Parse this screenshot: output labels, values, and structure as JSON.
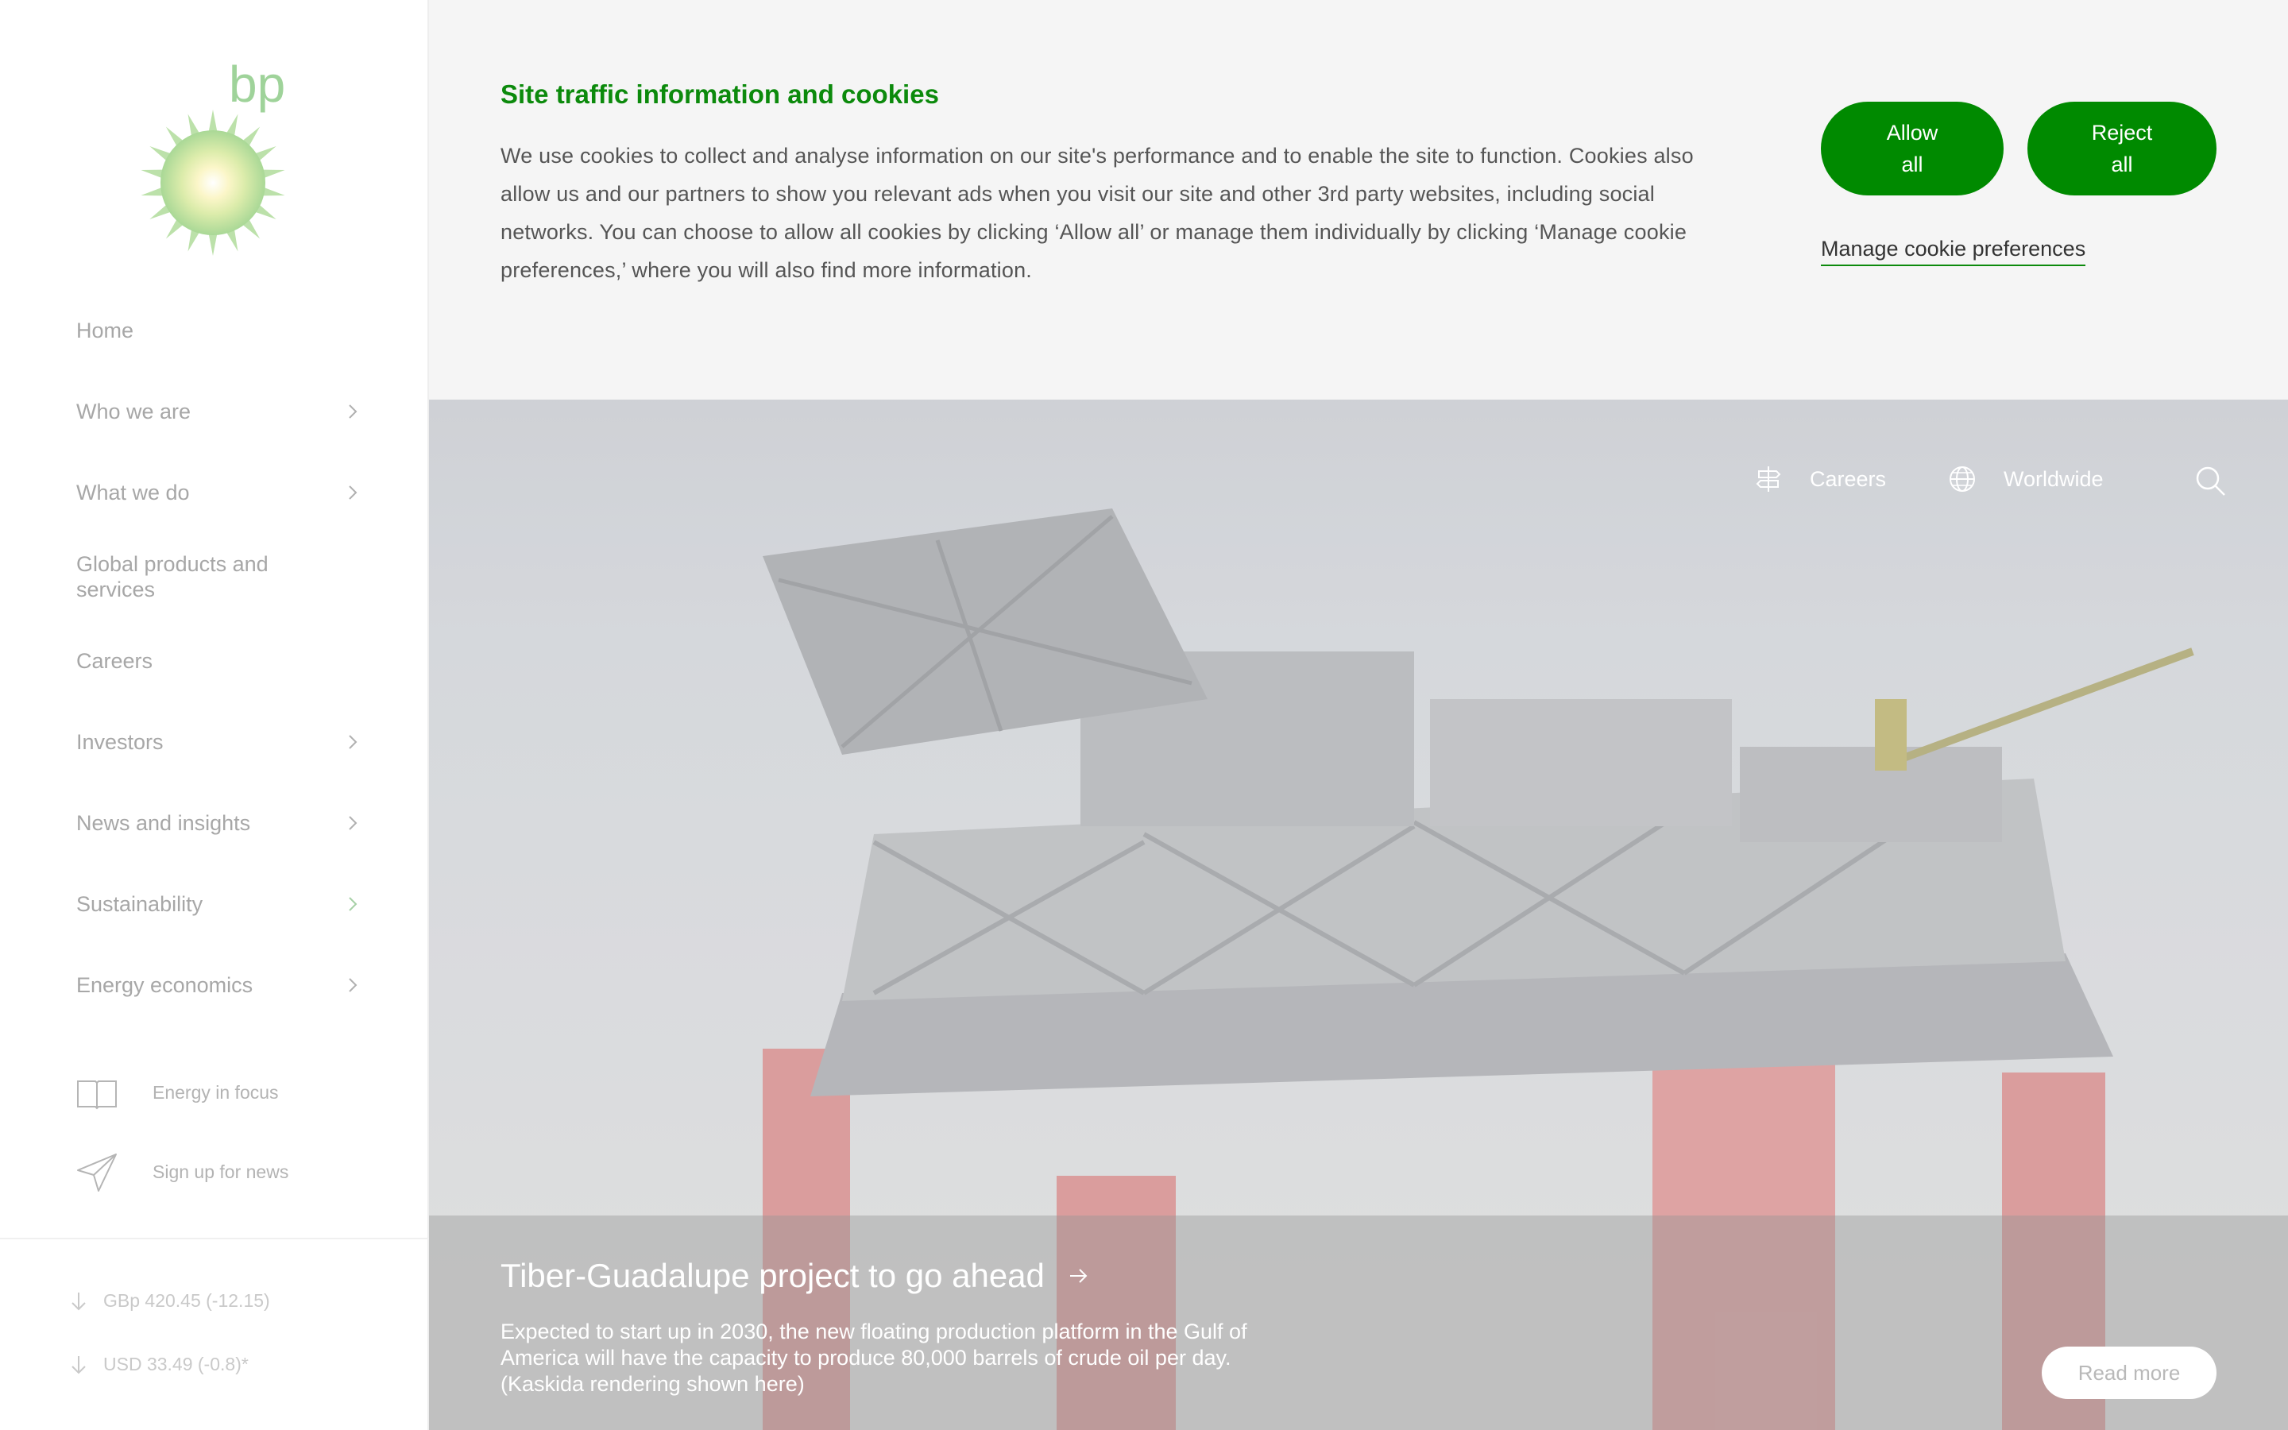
{
  "brand": {
    "logo_text": "bp",
    "accent": "#008a00"
  },
  "sidebar": {
    "nav": [
      {
        "label": "Home",
        "has_submenu": false
      },
      {
        "label": "Who we are",
        "has_submenu": true
      },
      {
        "label": "What we do",
        "has_submenu": true
      },
      {
        "label": "Global products and services",
        "has_submenu": false
      },
      {
        "label": "Careers",
        "has_submenu": false
      },
      {
        "label": "Investors",
        "has_submenu": true
      },
      {
        "label": "News and insights",
        "has_submenu": true
      },
      {
        "label": "Sustainability",
        "has_submenu": true
      },
      {
        "label": "Energy economics",
        "has_submenu": true
      }
    ],
    "utility": [
      {
        "label": "Energy in focus",
        "icon": "book-icon"
      },
      {
        "label": "Sign up for news",
        "icon": "paper-plane-icon"
      }
    ],
    "stock": [
      {
        "label": "GBp 420.45 (-12.15)",
        "icon": "arrow-down-icon"
      },
      {
        "label": "USD 33.49 (-0.8)*",
        "icon": "arrow-down-icon"
      }
    ]
  },
  "cookie_banner": {
    "title": "Site traffic information and cookies",
    "text": "We use cookies to collect and analyse information on our site's performance and to enable the site to function. Cookies also allow us and our partners to show you relevant ads when you visit our site and other 3rd party websites, including social networks. You can choose to allow all cookies by clicking ‘Allow all’ or manage them individually by clicking ‘Manage cookie preferences,’ where you will also find more information.",
    "allow_label": "Allow all",
    "reject_label": "Reject all",
    "manage_label": "Manage cookie preferences"
  },
  "topnav": {
    "careers_label": "Careers",
    "worldwide_label": "Worldwide",
    "icons": [
      "signpost-icon",
      "globe-icon",
      "search-icon"
    ]
  },
  "hero": {
    "title": "Tiber-Guadalupe project to go ahead",
    "description": "Expected to start up in 2030, the new floating production platform in the Gulf of America will have the capacity to produce 80,000 barrels of crude oil per day. (Kaskida rendering shown here)",
    "read_more_label": "Read more"
  }
}
